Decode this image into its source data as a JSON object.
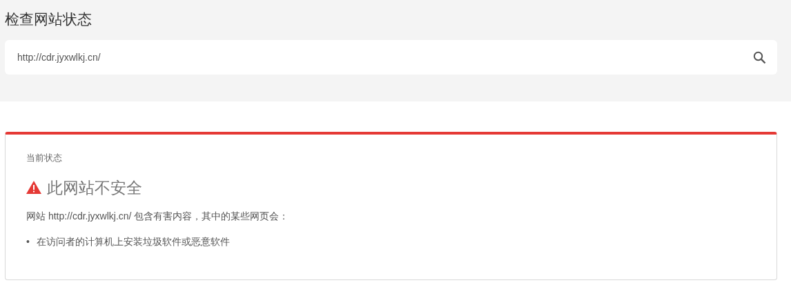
{
  "page_title": "检查网站状态",
  "search": {
    "value": "http://cdr.jyxwlkj.cn/"
  },
  "status": {
    "kind": "unsafe",
    "label": "当前状态",
    "heading": "此网站不安全",
    "description": "网站 http://cdr.jyxwlkj.cn/ 包含有害内容，其中的某些网页会：",
    "items": [
      {
        "bullet": "•",
        "text": "在访问者的计算机上安装垃圾软件或恶意软件"
      }
    ]
  }
}
